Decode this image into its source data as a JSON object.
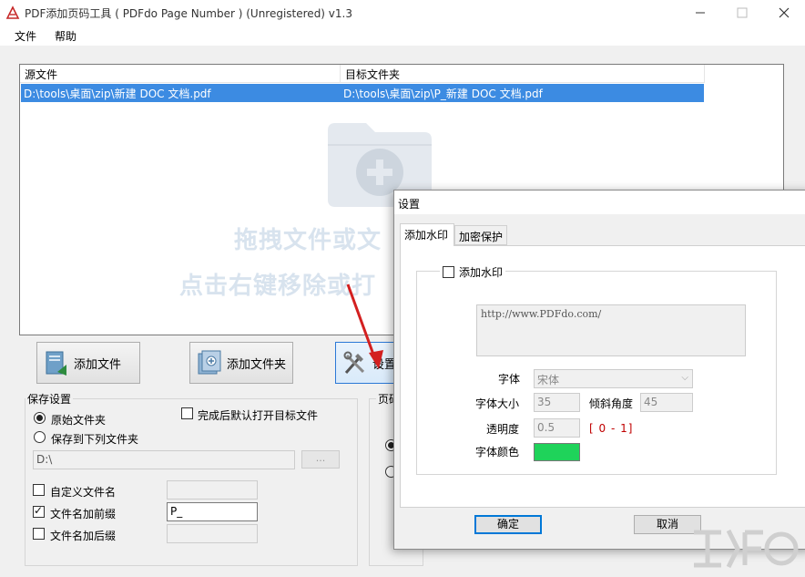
{
  "window": {
    "title": "PDF添加页码工具 ( PDFdo Page Number )  (Unregistered) v1.3"
  },
  "menu": {
    "file": "文件",
    "help": "帮助"
  },
  "file_list": {
    "columns": [
      "源文件",
      "目标文件夹"
    ],
    "rows": [
      {
        "source": "D:\\tools\\桌面\\zip\\新建 DOC 文档.pdf",
        "target": "D:\\tools\\桌面\\zip\\P_新建 DOC 文档.pdf"
      }
    ],
    "hint_line1": "拖拽文件或文",
    "hint_line2": "点击右键移除或打"
  },
  "buttons": {
    "add_file": "添加文件",
    "add_folder": "添加文件夹",
    "settings": "设置"
  },
  "save_settings": {
    "title": "保存设置",
    "original_folder": "原始文件夹",
    "save_to_folder": "保存到下列文件夹",
    "open_after": "完成后默认打开目标文件",
    "folder_path": "D:\\",
    "browse": "...",
    "custom_name": "自定义文件名",
    "add_prefix": "文件名加前缀",
    "prefix_value": "P_",
    "add_suffix": "文件名加后缀"
  },
  "page_group": {
    "title": "页码"
  },
  "dialog": {
    "title": "设置",
    "tabs": [
      "添加水印",
      "加密保护"
    ],
    "add_watermark": "添加水印",
    "watermark_text": "http://www.PDFdo.com/",
    "font_label": "字体",
    "font_value": "宋体",
    "font_size_label": "字体大小",
    "font_size_value": "35",
    "angle_label": "倾斜角度",
    "angle_value": "45",
    "opacity_label": "透明度",
    "opacity_value": "0.5",
    "opacity_range": "[ 0 - 1]",
    "color_label": "字体颜色",
    "color_value": "#1fd35a",
    "ok": "确定",
    "cancel": "取消"
  }
}
